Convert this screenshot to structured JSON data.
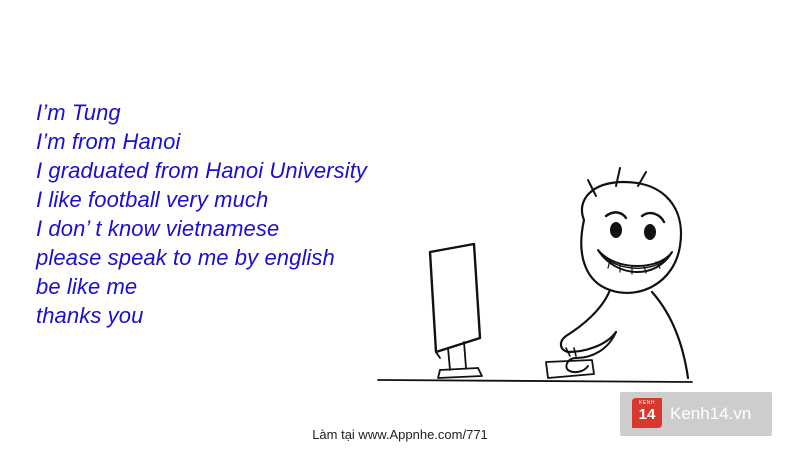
{
  "text_color": "#1b0ed1",
  "lines": [
    "I’m Tung",
    "I’m from Hanoi",
    "I graduated from Hanoi University",
    "I like football very much",
    "I don’ t know vietnamese",
    "please speak to me by english",
    "be like me",
    "thanks you"
  ],
  "footer": "Làm tại www.Appnhe.com/771",
  "logo": {
    "badge_small": "KENH",
    "badge_number": "14",
    "name": "Kenh14.vn",
    "badge_color": "#d9382e"
  }
}
